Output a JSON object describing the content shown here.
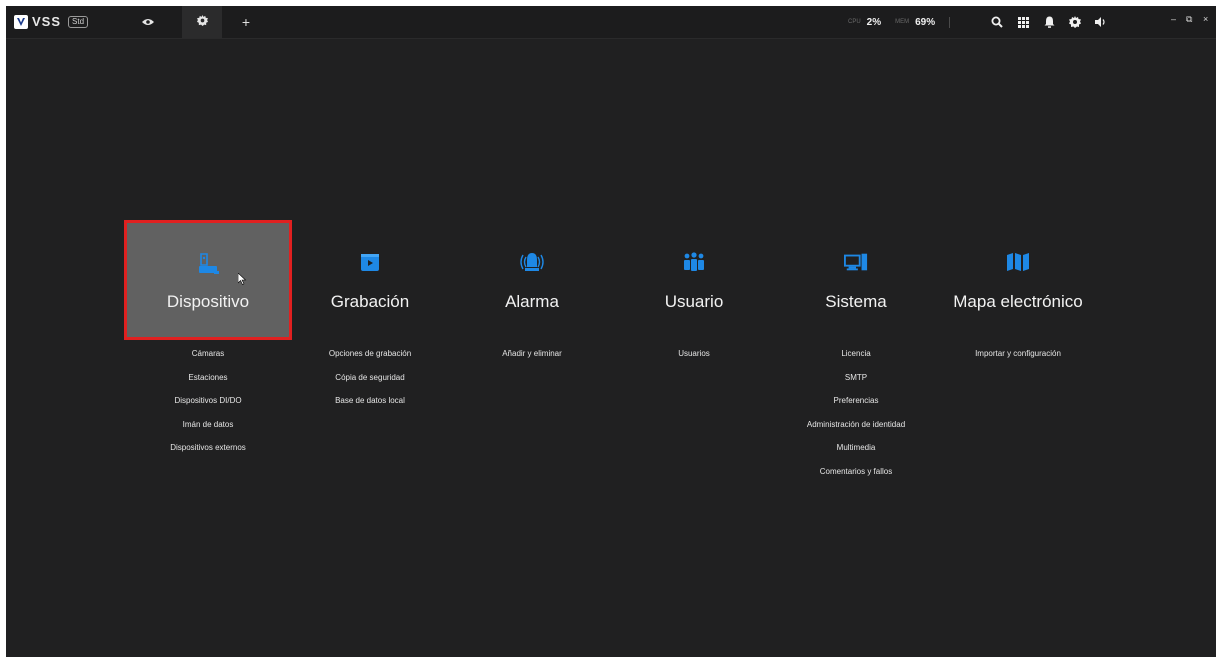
{
  "app": {
    "name": "VSS",
    "edition": "Std"
  },
  "stats": {
    "cpu_label": "CPU",
    "cpu_value": "2%",
    "mem_label": "MEM",
    "mem_value": "69%"
  },
  "tabs": [
    {
      "icon": "eye-icon"
    },
    {
      "icon": "gear-icon"
    },
    {
      "icon": "plus-icon",
      "label": "+"
    }
  ],
  "toolbar_icons": [
    "search-icon",
    "grid-icon",
    "bell-icon",
    "gear-icon",
    "volume-icon"
  ],
  "window_controls": {
    "minimize": "–",
    "restore": "⧉",
    "close": "×"
  },
  "colors": {
    "accent": "#1e88e5",
    "selected_border": "#e02020",
    "selected_bg": "#616161",
    "background": "#202021"
  },
  "menu": [
    {
      "title": "Dispositivo",
      "icon": "device-icon",
      "selected": true,
      "items": [
        "Cámaras",
        "Estaciones",
        "Dispositivos DI/DO",
        "Imán de datos",
        "Dispositivos externos"
      ]
    },
    {
      "title": "Grabación",
      "icon": "recording-icon",
      "items": [
        "Opciones de grabación",
        "Cópia de seguridad",
        "Base de datos local"
      ]
    },
    {
      "title": "Alarma",
      "icon": "alarm-icon",
      "items": [
        "Añadir y eliminar"
      ]
    },
    {
      "title": "Usuario",
      "icon": "users-icon",
      "items": [
        "Usuarios"
      ]
    },
    {
      "title": "Sistema",
      "icon": "system-icon",
      "items": [
        "Licencia",
        "SMTP",
        "Preferencias",
        "Administración de identidad",
        "Multimedia",
        "Comentarios y fallos"
      ]
    },
    {
      "title": "Mapa electrónico",
      "icon": "map-icon",
      "items": [
        "Importar y configuración"
      ]
    }
  ]
}
